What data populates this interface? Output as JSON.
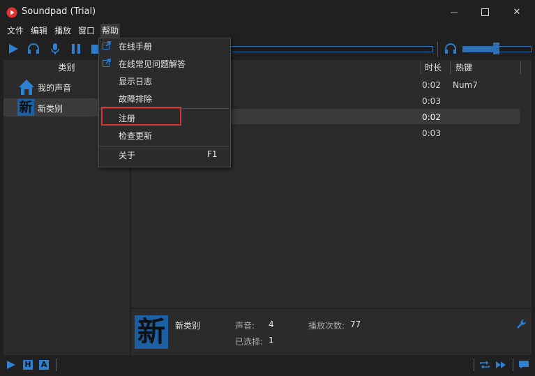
{
  "window": {
    "title": "Soundpad (Trial)",
    "minimize_glyph": "—",
    "maximize_glyph": "☐",
    "close_glyph": "✕"
  },
  "menubar": {
    "items": [
      "文件",
      "编辑",
      "播放",
      "窗口",
      "帮助"
    ]
  },
  "toolbar": {
    "icons": [
      "play-icon",
      "headphones-icon",
      "microphone-icon",
      "pause-icon",
      "stop-icon"
    ],
    "volume_level": 0.5
  },
  "left_panel": {
    "header": "类别",
    "categories": [
      {
        "label": "我的声音",
        "icon": "home-icon"
      },
      {
        "label": "新类别",
        "icon_text": "新"
      }
    ]
  },
  "sound_list": {
    "columns": {
      "duration": "时长",
      "hotkey": "热键"
    },
    "rows": [
      {
        "duration": "0:02",
        "hotkey": "Num7"
      },
      {
        "duration": "0:03",
        "hotkey": ""
      },
      {
        "duration": "0:02",
        "hotkey": ""
      },
      {
        "duration": "0:03",
        "hotkey": ""
      }
    ]
  },
  "info_panel": {
    "icon_text": "新",
    "category_name": "新类别",
    "sounds_label": "声音:",
    "sounds_value": "4",
    "plays_label": "播放次数:",
    "plays_value": "77",
    "selected_label": "已选择:",
    "selected_value": "1"
  },
  "status_bar": {
    "icons": [
      "play-mode-icon",
      "h-icon",
      "a-icon",
      "repeat-icon",
      "forward-icon",
      "chat-icon"
    ],
    "h_text": "H",
    "a_text": "A"
  },
  "help_menu": {
    "items": [
      {
        "label": "在线手册",
        "icon": "external-link-icon"
      },
      {
        "label": "在线常见问题解答",
        "icon": "external-link-icon"
      },
      {
        "label": "显示日志"
      },
      {
        "label": "故障排除"
      },
      {
        "label": "注册"
      },
      {
        "label": "检查更新"
      },
      {
        "label": "关于",
        "shortcut": "F1"
      }
    ]
  },
  "colors": {
    "accent": "#2f6fb3",
    "highlight": "#d9342b",
    "background": "#202020",
    "panel": "#2b2b2b"
  }
}
